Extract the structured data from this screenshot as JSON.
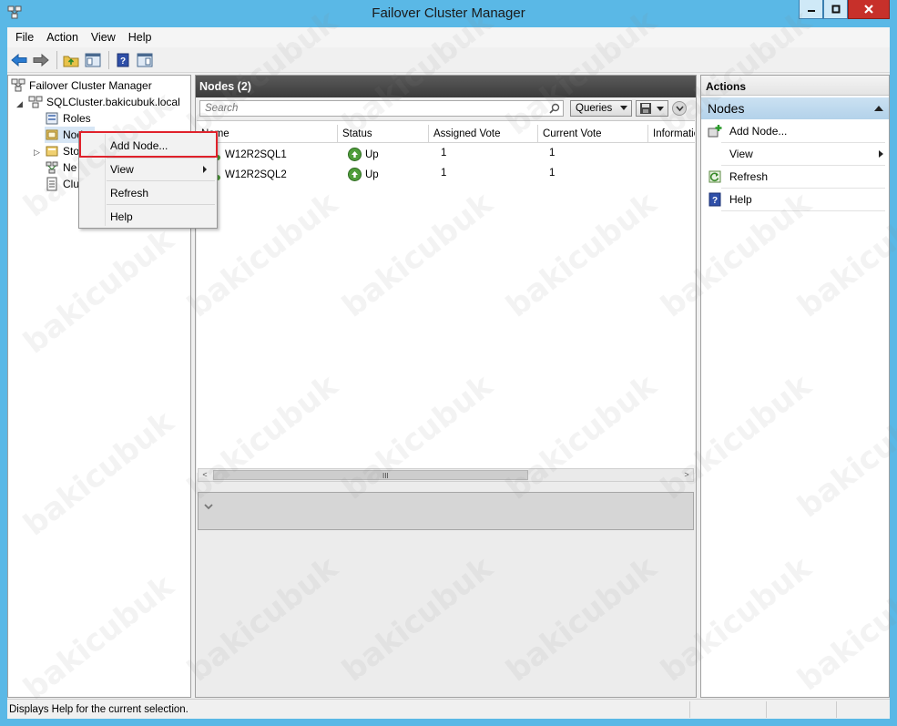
{
  "window": {
    "title": "Failover Cluster Manager"
  },
  "menubar": {
    "items": [
      "File",
      "Action",
      "View",
      "Help"
    ]
  },
  "tree": {
    "root": "Failover Cluster Manager",
    "cluster": "SQLCluster.bakicubuk.local",
    "roles": "Roles",
    "nodes": "Nodes",
    "storage": "Sto",
    "networks": "Ne",
    "cluster_events": "Clu"
  },
  "center": {
    "header": "Nodes (2)",
    "search_placeholder": "Search",
    "queries_label": "Queries",
    "columns": [
      "Name",
      "Status",
      "Assigned Vote",
      "Current Vote",
      "Information"
    ],
    "rows": [
      {
        "name": "W12R2SQL1",
        "status": "Up",
        "assigned_vote": "1",
        "current_vote": "1"
      },
      {
        "name": "W12R2SQL2",
        "status": "Up",
        "assigned_vote": "1",
        "current_vote": "1"
      }
    ],
    "scroll_grip": "III"
  },
  "actions": {
    "header": "Actions",
    "section": "Nodes",
    "items": [
      "Add Node...",
      "View",
      "Refresh",
      "Help"
    ]
  },
  "context_menu": {
    "items": [
      "Add Node...",
      "View",
      "Refresh",
      "Help"
    ]
  },
  "status": {
    "text": "Displays Help for the current selection."
  },
  "watermark": "bakicubuk",
  "colors": {
    "titlebar": "#5ab8e6",
    "selection": "#b3d2ea",
    "highlight_border": "#e0212b",
    "up_status": "#4f9d3a"
  }
}
